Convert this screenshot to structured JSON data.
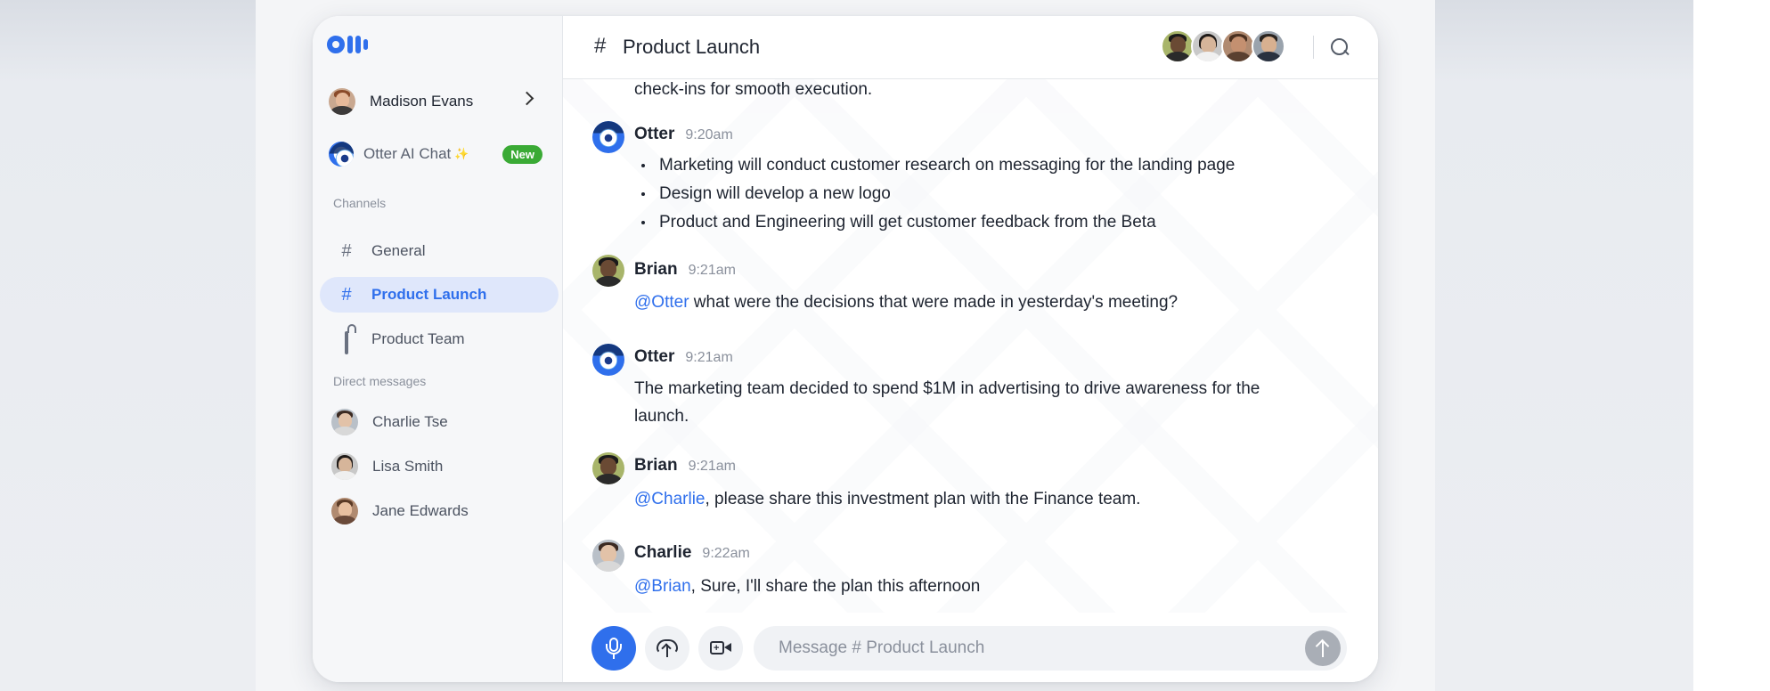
{
  "sidebar": {
    "user": {
      "name": "Madison Evans"
    },
    "ai_chat": {
      "label": "Otter AI Chat",
      "sparkle": "✨",
      "badge": "New"
    },
    "channels_heading": "Channels",
    "channels": [
      {
        "label": "General",
        "icon": "hash-icon",
        "glyph": "#"
      },
      {
        "label": "Product Launch",
        "icon": "hash-icon",
        "glyph": "#",
        "active": true
      },
      {
        "label": "Product Team",
        "icon": "lock-icon"
      }
    ],
    "dm_heading": "Direct messages",
    "dms": [
      {
        "label": "Charlie Tse"
      },
      {
        "label": "Lisa Smith"
      },
      {
        "label": "Jane Edwards"
      }
    ]
  },
  "header": {
    "hash": "#",
    "title": "Product Launch"
  },
  "messages": {
    "partial_text": "check-ins for smooth execution.",
    "m1": {
      "author": "Otter",
      "time": "9:20am",
      "bullets": [
        "Marketing will conduct customer research on messaging for the landing page",
        "Design will develop a new logo",
        "Product and Engineering will get customer feedback from the Beta"
      ]
    },
    "m2": {
      "author": "Brian",
      "time": "9:21am",
      "mention": "@Otter",
      "text": " what were the decisions that were made in yesterday's meeting?"
    },
    "m3": {
      "author": "Otter",
      "time": "9:21am",
      "line1": "The marketing team decided to spend $1M in advertising to drive awareness for the",
      "line2": "launch."
    },
    "m4": {
      "author": "Brian",
      "time": "9:21am",
      "mention": "@Charlie",
      "text": ", please share this investment plan with the Finance team."
    },
    "m5": {
      "author": "Charlie",
      "time": "9:22am",
      "mention": "@Brian",
      "text": ", Sure, I'll share the plan this afternoon"
    }
  },
  "composer": {
    "placeholder": "Message # Product Launch"
  },
  "colors": {
    "accent": "#2f6fec",
    "badge_green": "#3aaa35",
    "active_bg": "#dfe7fb"
  }
}
